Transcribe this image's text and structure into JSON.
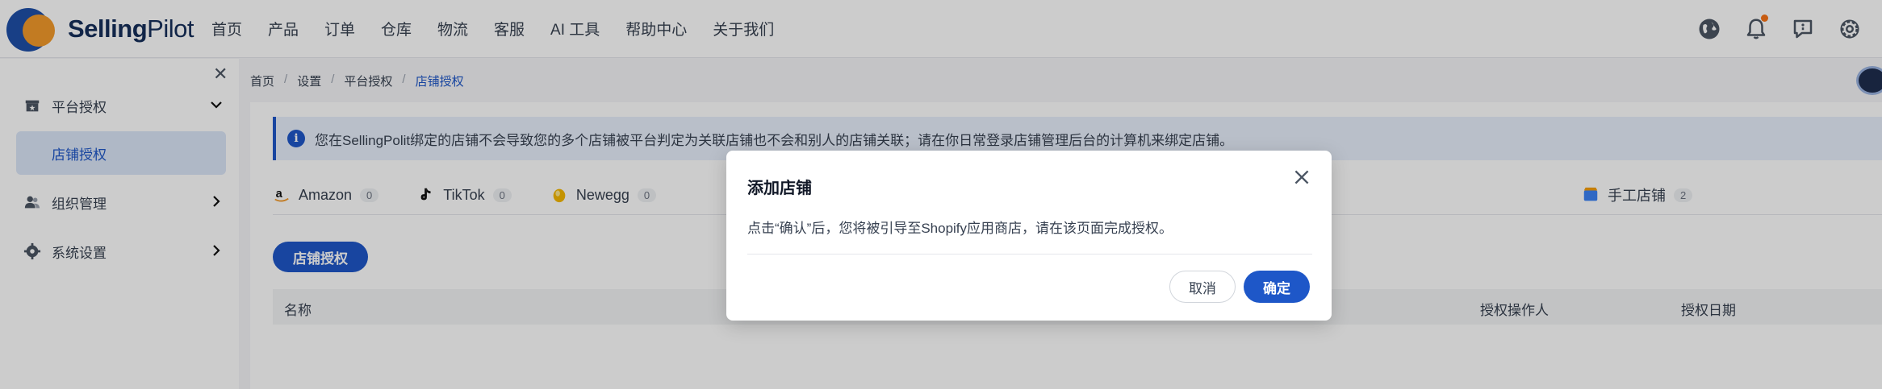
{
  "app": {
    "brand_part1": "Selling",
    "brand_part2": "Pilot"
  },
  "nav": [
    "首页",
    "产品",
    "订单",
    "仓库",
    "物流",
    "客服",
    "AI 工具",
    "帮助中心",
    "关于我们"
  ],
  "header_icons": [
    "globe-icon",
    "bell-icon",
    "message-icon",
    "gear-icon"
  ],
  "sidebar": {
    "items": [
      {
        "label": "平台授权",
        "icon": "store-icon",
        "expanded": true
      },
      {
        "label": "店铺授权",
        "active": true
      },
      {
        "label": "组织管理",
        "icon": "users-icon"
      },
      {
        "label": "系统设置",
        "icon": "gear-icon"
      }
    ]
  },
  "breadcrumb": [
    "首页",
    "设置",
    "平台授权",
    "店铺授权"
  ],
  "notice": "您在SellingPolit绑定的店铺不会导致您的多个店铺被平台判定为关联店铺也不会和别人的店铺关联；请在你日常登录店铺管理后台的计算机来绑定店铺。",
  "tabs": [
    {
      "label": "Amazon",
      "count": "0"
    },
    {
      "label": "TikTok",
      "count": "0"
    },
    {
      "label": "Newegg",
      "count": "0"
    },
    {
      "label": "手工店铺",
      "count": "2"
    }
  ],
  "auth_button": "店铺授权",
  "table": {
    "columns": [
      "名称",
      "授权操作人",
      "授权日期"
    ]
  },
  "modal": {
    "title": "添加店铺",
    "body": "点击“确认”后，您将被引导至Shopify应用商店，请在该页面完成授权。",
    "cancel": "取消",
    "confirm": "确定"
  },
  "colors": {
    "primary": "#1e57c8",
    "brand_navy": "#162f5a",
    "brand_orange": "#f39a2b",
    "notification_dot": "#f97316"
  }
}
